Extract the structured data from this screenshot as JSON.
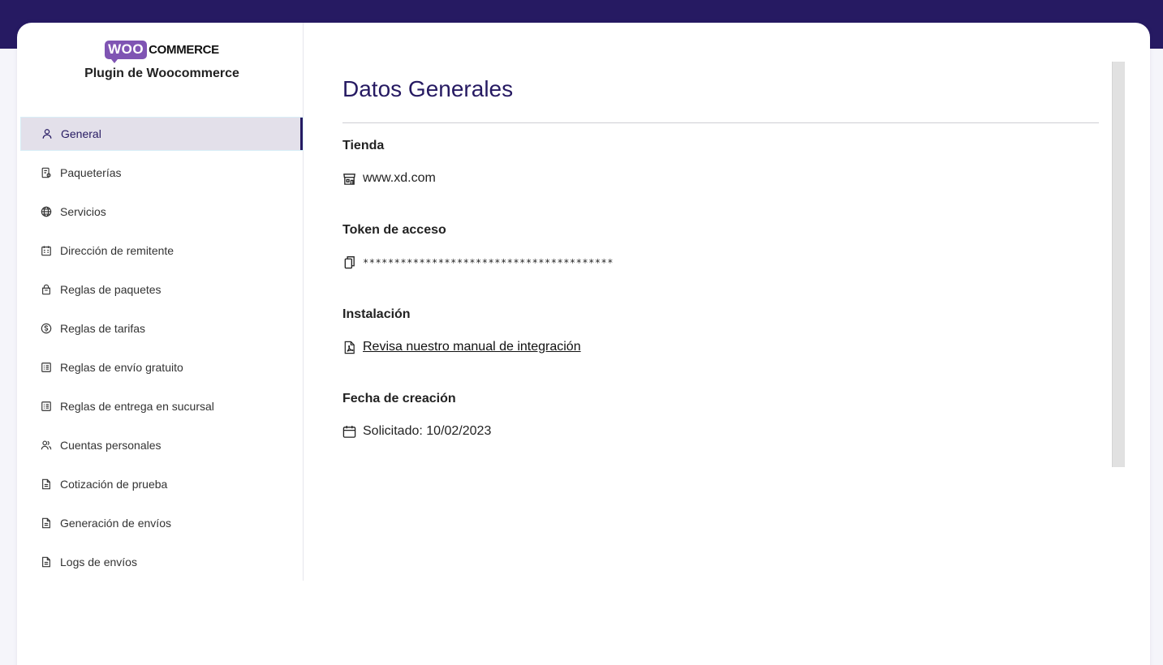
{
  "brand": {
    "logo_woo": "WOO",
    "logo_commerce": "COMMERCE",
    "subtitle": "Plugin de Woocommerce"
  },
  "sidebar": {
    "items": [
      {
        "label": "General",
        "icon": "user-icon",
        "active": true
      },
      {
        "label": "Paqueterías",
        "icon": "receipt-icon"
      },
      {
        "label": "Servicios",
        "icon": "globe-icon"
      },
      {
        "label": "Dirección de remitente",
        "icon": "building-icon"
      },
      {
        "label": "Reglas de paquetes",
        "icon": "package-icon"
      },
      {
        "label": "Reglas de tarifas",
        "icon": "dollar-circle-icon"
      },
      {
        "label": "Reglas de envío gratuito",
        "icon": "list-icon"
      },
      {
        "label": "Reglas de entrega en sucursal",
        "icon": "list-icon"
      },
      {
        "label": "Cuentas personales",
        "icon": "users-icon"
      },
      {
        "label": "Cotización de prueba",
        "icon": "document-icon"
      },
      {
        "label": "Generación de envíos",
        "icon": "document-icon"
      },
      {
        "label": "Logs de envíos",
        "icon": "document-icon"
      }
    ]
  },
  "main": {
    "title": "Datos Generales",
    "sections": {
      "store": {
        "label": "Tienda",
        "value": "www.xd.com",
        "icon": "store-icon"
      },
      "token": {
        "label": "Token de acceso",
        "value": "****************************************",
        "icon": "copy-icon"
      },
      "install": {
        "label": "Instalación",
        "value": "Revisa nuestro manual de integración",
        "icon": "pdf-icon"
      },
      "created": {
        "label": "Fecha de creación",
        "value": "Solicitado: 10/02/2023",
        "icon": "calendar-icon"
      }
    }
  },
  "colors": {
    "brand_dark": "#261a62",
    "woo_purple": "#7f54b3",
    "active_bg": "#e3e0ea"
  }
}
